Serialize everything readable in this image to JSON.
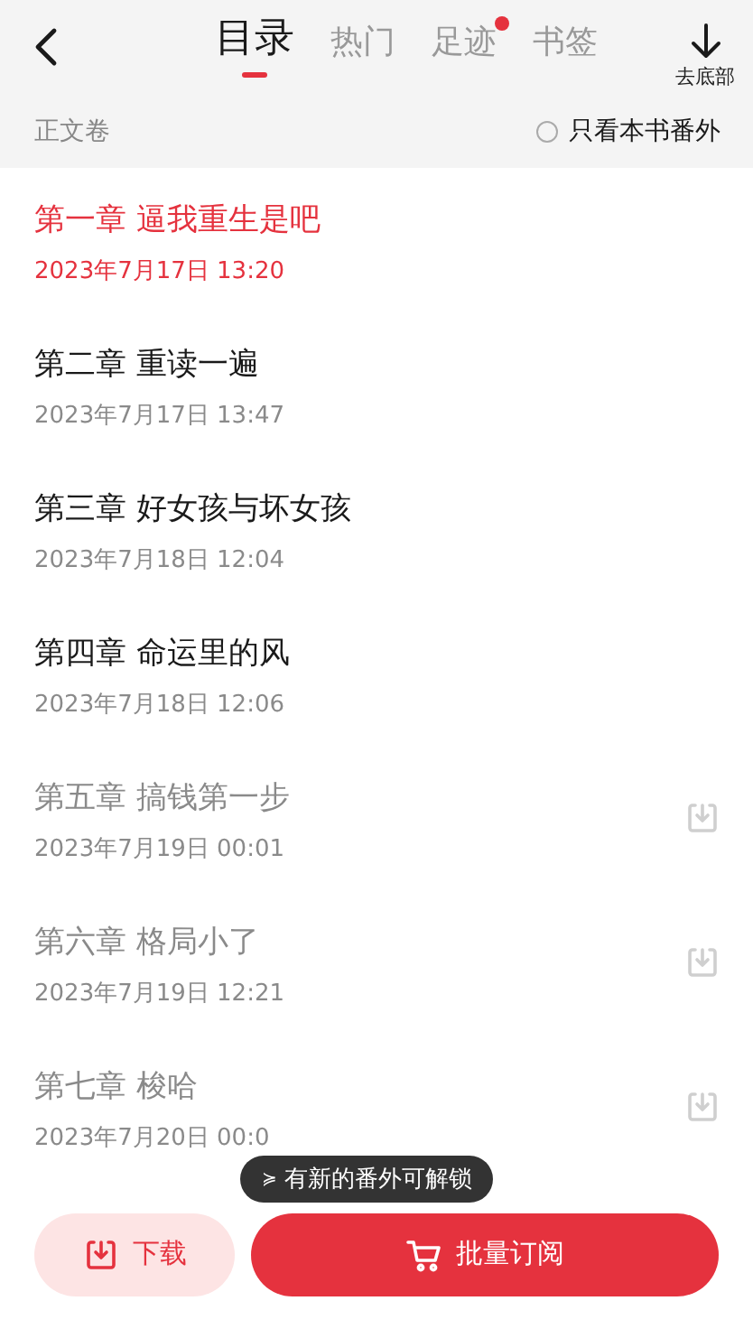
{
  "header": {
    "tabs": [
      {
        "label": "目录",
        "selected": true,
        "dot": false
      },
      {
        "label": "热门",
        "selected": false,
        "dot": false
      },
      {
        "label": "足迹",
        "selected": false,
        "dot": true
      },
      {
        "label": "书签",
        "selected": false,
        "dot": false
      }
    ],
    "to_bottom": "去底部"
  },
  "volume": {
    "title": "正文卷",
    "filter": {
      "label": "只看本书番外",
      "checked": false
    }
  },
  "chapters": [
    {
      "title": "第一章 逼我重生是吧",
      "date": "2023年7月17日 13:20",
      "selected": true,
      "locked": false
    },
    {
      "title": "第二章 重读一遍",
      "date": "2023年7月17日 13:47",
      "selected": false,
      "locked": false
    },
    {
      "title": "第三章 好女孩与坏女孩",
      "date": "2023年7月18日 12:04",
      "selected": false,
      "locked": false
    },
    {
      "title": "第四章 命运里的风",
      "date": "2023年7月18日 12:06",
      "selected": false,
      "locked": false
    },
    {
      "title": "第五章 搞钱第一步",
      "date": "2023年7月19日 00:01",
      "selected": false,
      "locked": true
    },
    {
      "title": "第六章 格局小了",
      "date": "2023年7月19日 12:21",
      "selected": false,
      "locked": true
    },
    {
      "title": "第七章 梭哈",
      "date": "2023年7月20日 00:0",
      "selected": false,
      "locked": true
    }
  ],
  "toast": {
    "icon": "≽",
    "text": "有新的番外可解锁"
  },
  "actions": {
    "download": "下载",
    "subscribe": "批量订阅"
  }
}
